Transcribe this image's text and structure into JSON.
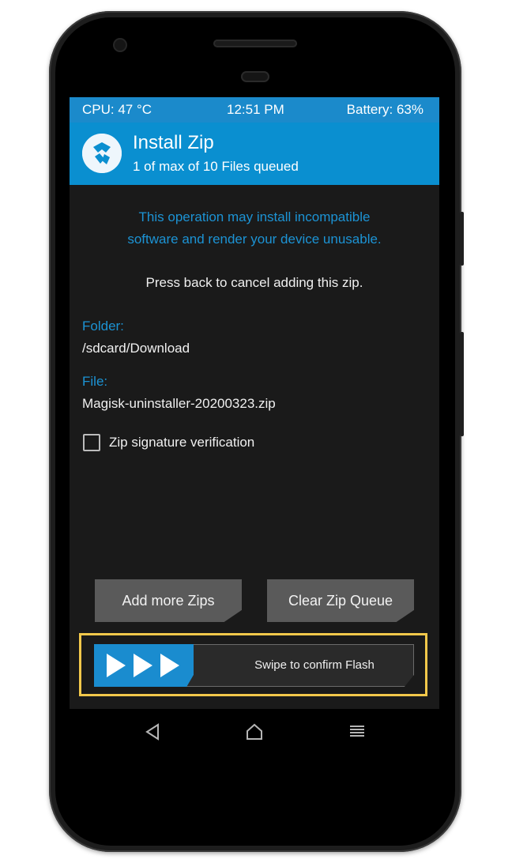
{
  "status": {
    "cpu": "CPU: 47 °C",
    "time": "12:51 PM",
    "battery": "Battery: 63%"
  },
  "header": {
    "title": "Install Zip",
    "subtitle": "1 of max of 10 Files queued",
    "logo_icon": "twrp-logo-icon"
  },
  "warning": {
    "line1": "This operation may install incompatible",
    "line2": "software and render your device unusable."
  },
  "notice": "Press back to cancel adding this zip.",
  "folder": {
    "label": "Folder:",
    "value": "/sdcard/Download"
  },
  "file": {
    "label": "File:",
    "value": "Magisk-uninstaller-20200323.zip"
  },
  "options": {
    "zip_signature_label": "Zip signature verification",
    "zip_signature_checked": false
  },
  "buttons": {
    "add_more": "Add more Zips",
    "clear_queue": "Clear Zip Queue"
  },
  "swipe": {
    "label": "Swipe to confirm Flash"
  },
  "colors": {
    "accent": "#0a8fd0",
    "highlight": "#f2c84b",
    "button": "#5a5a5a"
  },
  "nav": {
    "back_icon": "back-triangle-icon",
    "home_icon": "home-icon",
    "menu_icon": "menu-icon"
  }
}
